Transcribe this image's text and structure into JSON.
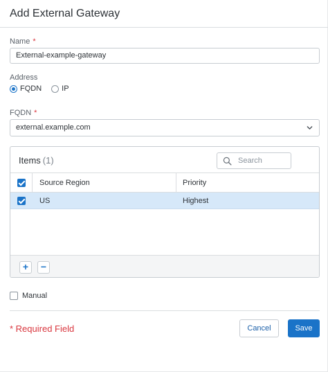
{
  "dialog": {
    "title": "Add External Gateway"
  },
  "form": {
    "name_label": "Name",
    "name_required_mark": "*",
    "name_value": "External-example-gateway",
    "address_label": "Address",
    "address_options": [
      {
        "label": "FQDN",
        "selected": true
      },
      {
        "label": "IP",
        "selected": false
      }
    ],
    "fqdn_label": "FQDN",
    "fqdn_required_mark": "*",
    "fqdn_value": "external.example.com"
  },
  "items_table": {
    "title": "Items",
    "count": "(1)",
    "search_placeholder": "Search",
    "columns": [
      "Source Region",
      "Priority"
    ],
    "header_checked": true,
    "rows": [
      {
        "checked": true,
        "source_region": "US",
        "priority": "Highest"
      }
    ],
    "add_label": "+",
    "remove_label": "−"
  },
  "manual": {
    "label": "Manual",
    "checked": false
  },
  "footer": {
    "required_note": "* Required Field",
    "cancel_label": "Cancel",
    "save_label": "Save"
  },
  "colors": {
    "accent": "#1a73c8",
    "required": "#d9363e",
    "selected_row": "#d6e8f9"
  },
  "icons": {
    "search": "search-icon",
    "dropdown": "chevron-down-icon"
  }
}
